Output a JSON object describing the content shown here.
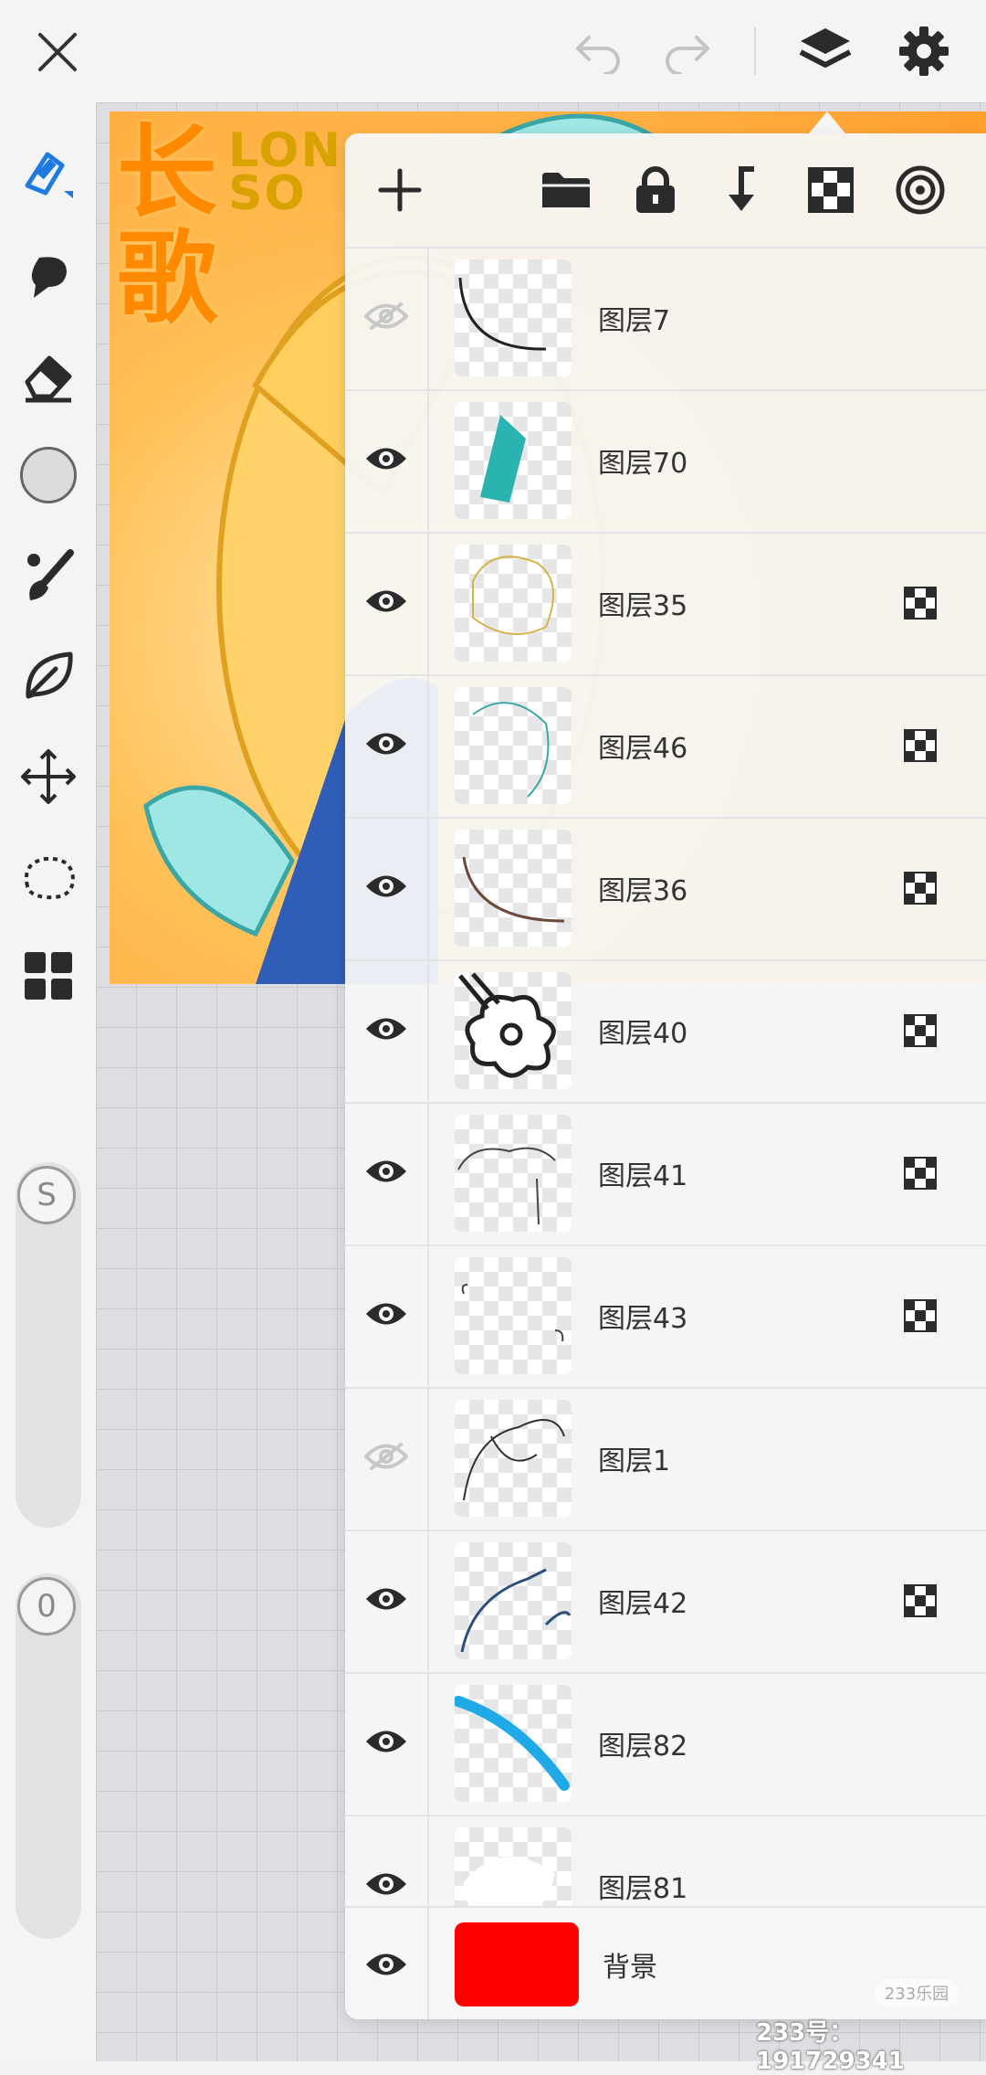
{
  "topbar": {
    "close_icon": "close-icon",
    "undo_icon": "undo-icon",
    "redo_icon": "redo-icon",
    "layers_icon": "layers-icon",
    "settings_icon": "gear-icon"
  },
  "artwork": {
    "title_cn": "长\n歌",
    "title_en": "LON\nSO"
  },
  "lefttools": {
    "tools": [
      "pen-icon",
      "smudge-icon",
      "eraser-icon",
      "color-circle-icon",
      "brush-icon",
      "leaf-icon",
      "move-icon",
      "lasso-icon",
      "grid-menu-icon"
    ],
    "size_label": "S",
    "opacity_label": "0"
  },
  "panel": {
    "toolbar": [
      "add-icon",
      "folder-icon",
      "lock-icon",
      "merge-down-icon",
      "checker-icon",
      "target-icon"
    ],
    "layers": [
      {
        "name": "图层7",
        "visible": false,
        "clip": false
      },
      {
        "name": "图层70",
        "visible": true,
        "clip": false
      },
      {
        "name": "图层35",
        "visible": true,
        "clip": true
      },
      {
        "name": "图层46",
        "visible": true,
        "clip": true
      },
      {
        "name": "图层36",
        "visible": true,
        "clip": true
      },
      {
        "name": "图层40",
        "visible": true,
        "clip": true
      },
      {
        "name": "图层41",
        "visible": true,
        "clip": true
      },
      {
        "name": "图层43",
        "visible": true,
        "clip": true
      },
      {
        "name": "图层1",
        "visible": false,
        "clip": false
      },
      {
        "name": "图层42",
        "visible": true,
        "clip": true
      },
      {
        "name": "图层82",
        "visible": true,
        "clip": false
      },
      {
        "name": "图层81",
        "visible": true,
        "clip": false
      }
    ],
    "background": {
      "name": "背景",
      "visible": true,
      "color": "#ff0000"
    }
  },
  "watermark": {
    "id_text": "233号： 191729341",
    "badge": "233乐园"
  }
}
